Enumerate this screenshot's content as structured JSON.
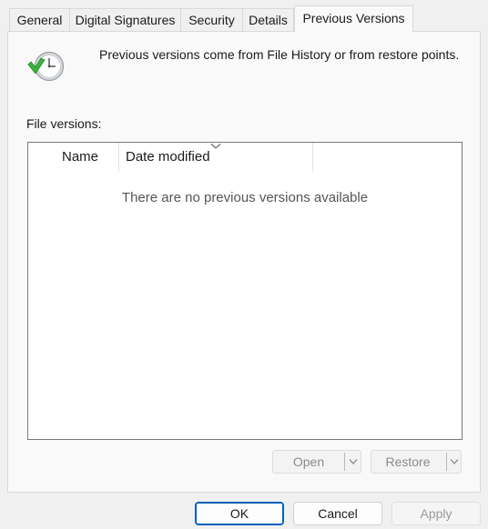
{
  "tabs": [
    {
      "label": "General",
      "selected": false
    },
    {
      "label": "Digital Signatures",
      "selected": false
    },
    {
      "label": "Security",
      "selected": false
    },
    {
      "label": "Details",
      "selected": false
    },
    {
      "label": "Previous Versions",
      "selected": true
    }
  ],
  "info": {
    "icon": "restore-clock-icon",
    "text": "Previous versions come from File History or from restore points."
  },
  "file_versions": {
    "label": "File versions:",
    "columns": [
      "Name",
      "Date modified"
    ],
    "sorted_column": "Date modified",
    "sort_icon": "chevron-down-icon",
    "empty_message": "There are no previous versions available"
  },
  "actions": {
    "open_label": "Open",
    "restore_label": "Restore"
  },
  "dialog_buttons": {
    "ok_label": "OK",
    "cancel_label": "Cancel",
    "apply_label": "Apply"
  },
  "colors": {
    "accent": "#005fb8",
    "icon_green": "#3cb43c"
  }
}
